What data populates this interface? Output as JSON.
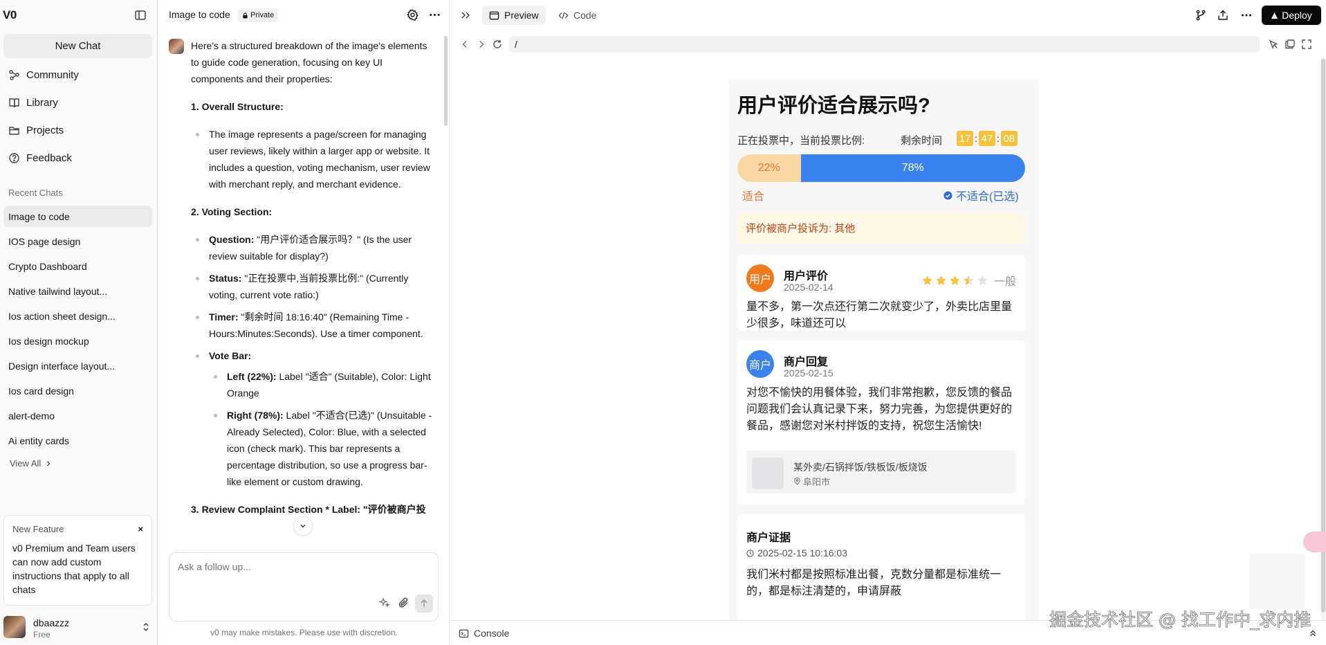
{
  "sidebar": {
    "logo": "V0",
    "new_chat": "New Chat",
    "nav": [
      {
        "label": "Community",
        "icon": "community-icon"
      },
      {
        "label": "Library",
        "icon": "library-icon"
      },
      {
        "label": "Projects",
        "icon": "folder-icon"
      },
      {
        "label": "Feedback",
        "icon": "help-icon"
      }
    ],
    "recent_title": "Recent Chats",
    "recent": [
      "Image to code",
      "IOS page design",
      "Crypto Dashboard",
      "Native tailwind layout...",
      "Ios action sheet design...",
      "Ios design mockup",
      "Design interface layout...",
      "Ios card design",
      "alert-demo",
      "Ai entity cards"
    ],
    "view_all": "View All",
    "feature": {
      "title": "New Feature",
      "close": "×",
      "text": "v0 Premium and Team users can now add custom instructions that apply to all chats"
    },
    "user": {
      "name": "dbaazzz",
      "plan": "Free"
    }
  },
  "chat": {
    "title": "Image to code",
    "badge": "Private",
    "message": {
      "intro": "Here's a structured breakdown of the image's elements to guide code generation, focusing on key UI components and their properties:",
      "h1": "1. Overall Structure:",
      "s1": "The image represents a page/screen for managing user reviews, likely within a larger app or website. It includes a question, voting mechanism, user review with merchant reply, and merchant evidence.",
      "h2": "2. Voting Section:",
      "q_label": "Question:",
      "q_text": " \"用户评价适合展示吗？\" (Is the user review suitable for display?)",
      "st_label": "Status:",
      "st_text": " \"正在投票中,当前投票比例:\" (Currently voting, current vote ratio:)",
      "ti_label": "Timer:",
      "ti_text": " \"剩余时间 18:16:40\" (Remaining Time - Hours:Minutes:Seconds). Use a timer component.",
      "vb_label": "Vote Bar:",
      "left_label": "Left (22%):",
      "left_text": " Label \"适合\" (Suitable), Color: Light Orange",
      "right_label": "Right (78%):",
      "right_text": " Label \"不适合(已选)\" (Unsuitable - Already Selected), Color: Blue, with a selected icon (check mark). This bar represents a percentage distribution, so use a progress bar-like element or custom drawing.",
      "h3": "3. Review Complaint Section * Label: \"评价被商户投"
    },
    "input_placeholder": "Ask a follow up...",
    "disclaimer": "v0 may make mistakes. Please use with discretion."
  },
  "preview": {
    "tab_preview": "Preview",
    "tab_code": "Code",
    "deploy": "Deploy",
    "url": "/",
    "console": "Console",
    "watermark": "掘金技术社区 @ 找工作中_求内推"
  },
  "app": {
    "title": "用户评价适合展示吗?",
    "vote_status": "正在投票中，当前投票比例:",
    "timer_label": "剩余时间",
    "timer": {
      "h": "17",
      "m": "47",
      "s": "08",
      "sep": ":"
    },
    "vote": {
      "left_pct": 22,
      "right_pct": 78,
      "left_text": "22%",
      "right_text": "78%",
      "left_label": "适合",
      "right_label": "不适合(已选)"
    },
    "colors": {
      "left": "#fbd7a6",
      "right": "#3a83ee",
      "timer": "#f9c23c",
      "user_avatar": "#f07a1b",
      "merchant_avatar": "#3a83ee"
    },
    "complaint": "评价被商户投诉为: 其他",
    "review": {
      "avatar": "用户",
      "name": "用户评价",
      "date": "2025-02-14",
      "stars": 3.5,
      "max_stars": 5,
      "rating_text": "一般",
      "text": "量不多，第一次点还行第二次就变少了，外卖比店里量少很多，味道还可以"
    },
    "reply": {
      "avatar": "商户",
      "name": "商户回复",
      "date": "2025-02-15",
      "text": "对您不愉快的用餐体验，我们非常抱歉，您反馈的餐品问题我们会认真记录下来，努力完善，为您提供更好的餐品，感谢您对米村拌饭的支持，祝您生活愉快!",
      "store": "某外卖/石锅拌饭/铁板饭/板烧饭",
      "location": "阜阳市"
    },
    "evidence": {
      "title": "商户证据",
      "time": "2025-02-15 10:16:03",
      "text": "我们米村都是按照标准出餐，克数分量都是标准统一的，都是标注清楚的，申请屏蔽"
    }
  }
}
